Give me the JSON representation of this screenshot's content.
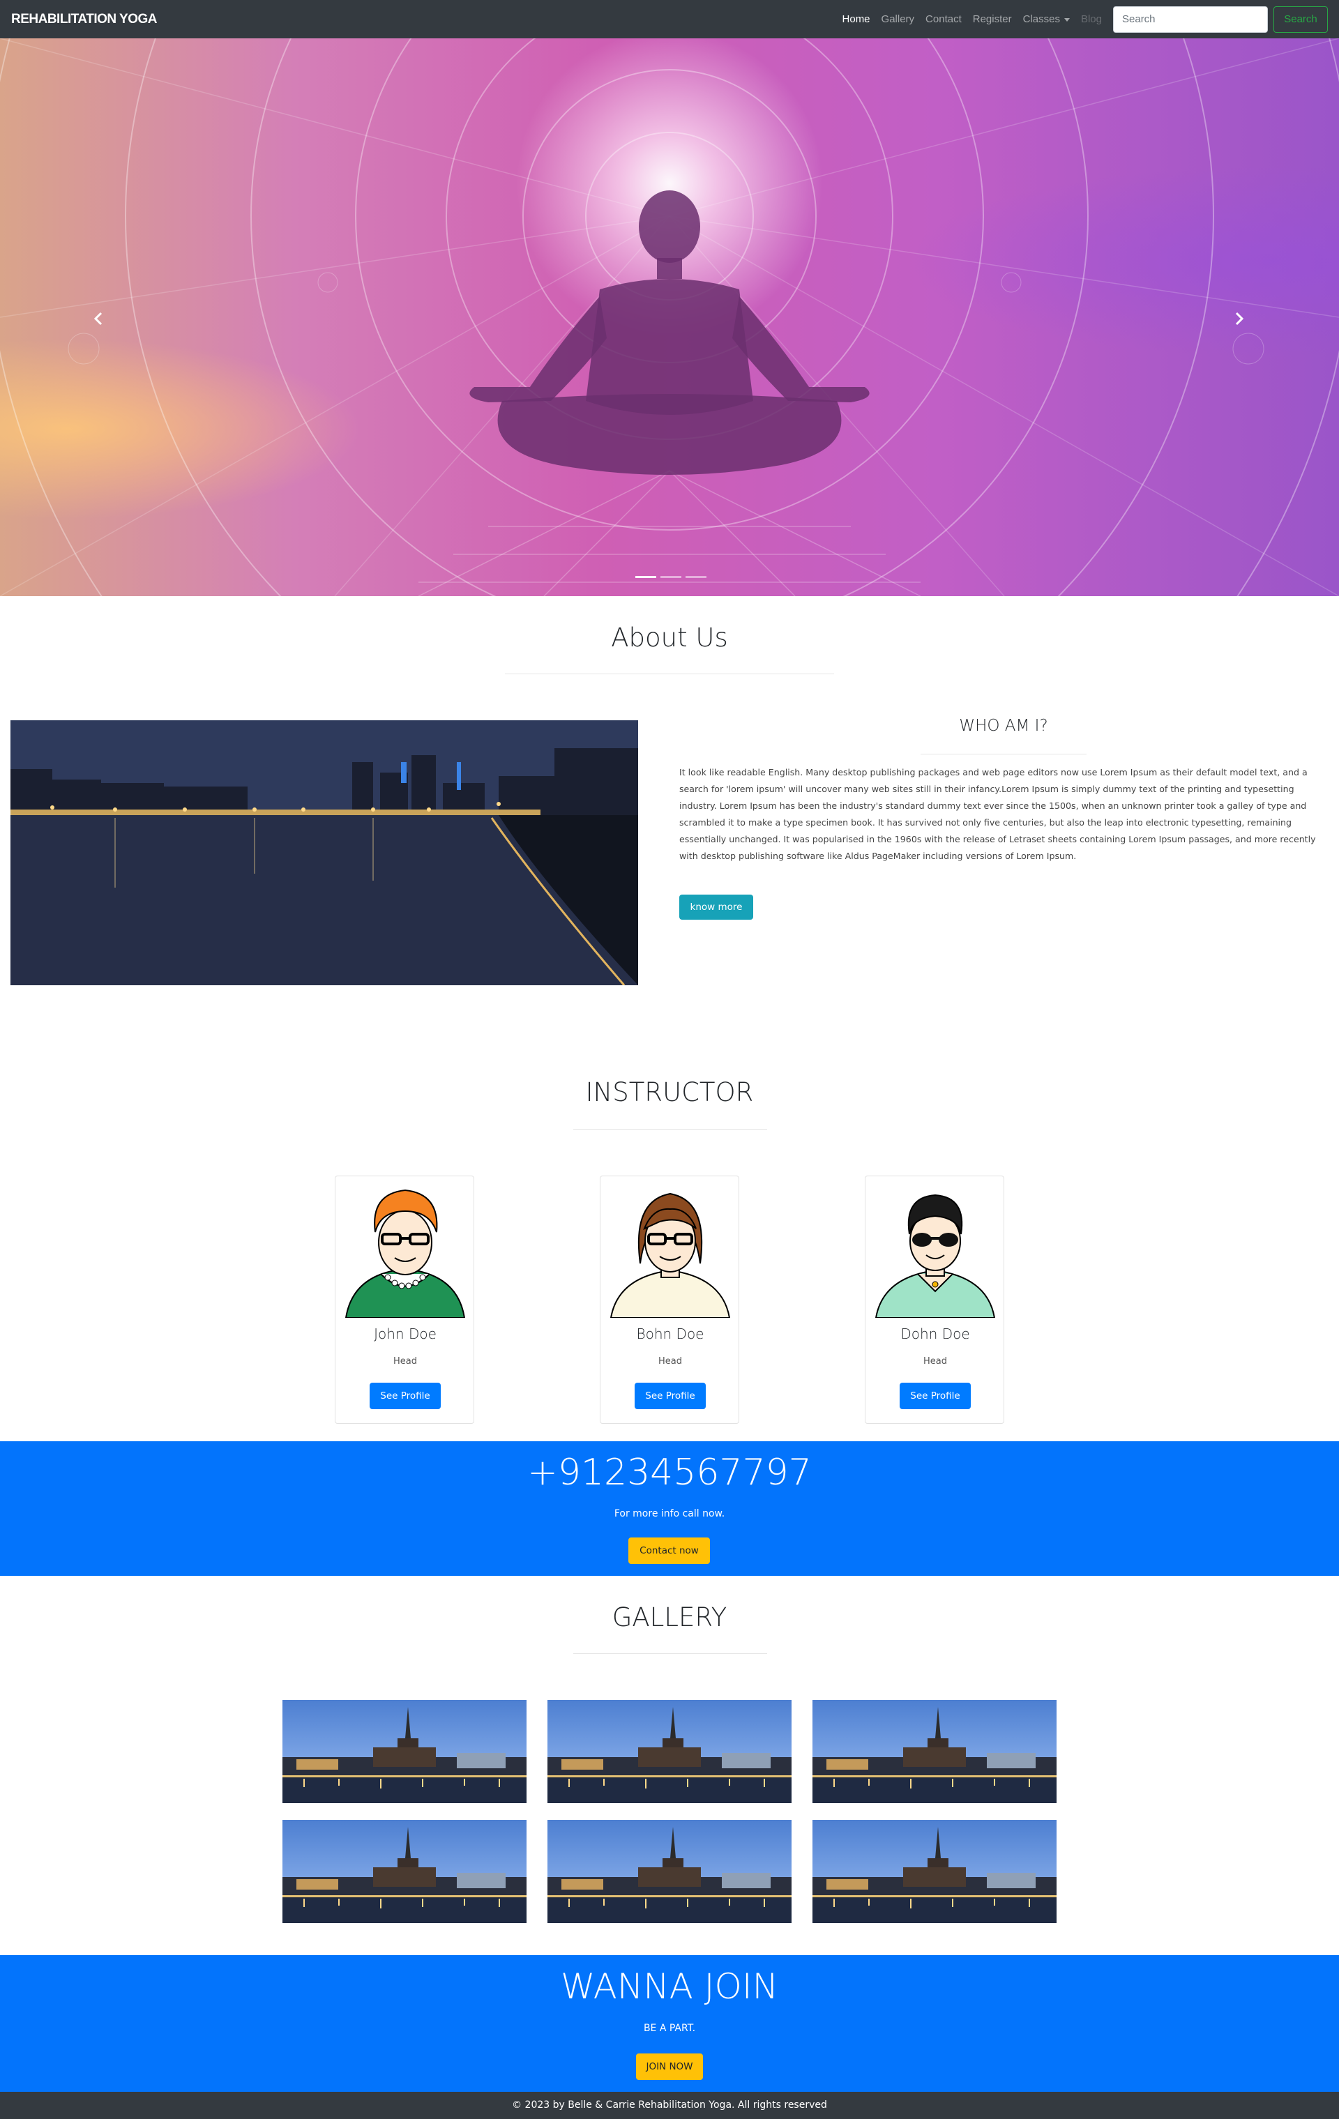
{
  "navbar": {
    "brand": "REHABILITATION YOGA",
    "links": [
      {
        "label": "Home"
      },
      {
        "label": "Gallery"
      },
      {
        "label": "Contact"
      },
      {
        "label": "Register"
      },
      {
        "label": "Classes"
      },
      {
        "label": "Blog"
      }
    ],
    "search_placeholder": "Search",
    "search_button": "Search"
  },
  "hero": {
    "slide_count": 3,
    "active_slide": 1,
    "prev_icon": "chevron-left-icon",
    "next_icon": "chevron-right-icon"
  },
  "about": {
    "title": "About Us",
    "who_title": "WHO AM I?",
    "text": "It look like readable English. Many desktop publishing packages and web page editors now use Lorem Ipsum as their default model text, and a search for 'lorem ipsum' will uncover many web sites still in their infancy.Lorem Ipsum is simply dummy text of the printing and typesetting industry. Lorem Ipsum has been the industry's standard dummy text ever since the 1500s, when an unknown printer took a galley of type and scrambled it to make a type specimen book. It has survived not only five centuries, but also the leap into electronic typesetting, remaining essentially unchanged. It was popularised in the 1960s with the release of Letraset sheets containing Lorem Ipsum passages, and more recently with desktop publishing software like Aldus PageMaker including versions of Lorem Ipsum.",
    "button": "know more"
  },
  "instructor": {
    "title": "INSTRUCTOR",
    "cards": [
      {
        "name": "John Doe",
        "role": "Head",
        "button": "See Profile"
      },
      {
        "name": "Bohn Doe",
        "role": "Head",
        "button": "See Profile"
      },
      {
        "name": "Dohn Doe",
        "role": "Head",
        "button": "See Profile"
      }
    ]
  },
  "call": {
    "phone": "+91234567797",
    "subtitle": "For more info call now.",
    "button": "Contact now"
  },
  "gallery": {
    "title": "GALLERY",
    "image_count": 6
  },
  "join": {
    "title": "WANNA JOIN",
    "subtitle": "BE A PART.",
    "button": "JOIN NOW"
  },
  "footer": {
    "text": "© 2023 by Belle & Carrie Rehabilitation Yoga. All rights reserved"
  },
  "colors": {
    "navbar": "#343a40",
    "primary": "#007bff",
    "band": "#0374fc",
    "info": "#17a2b8",
    "warning": "#ffc107",
    "success": "#28a745"
  }
}
